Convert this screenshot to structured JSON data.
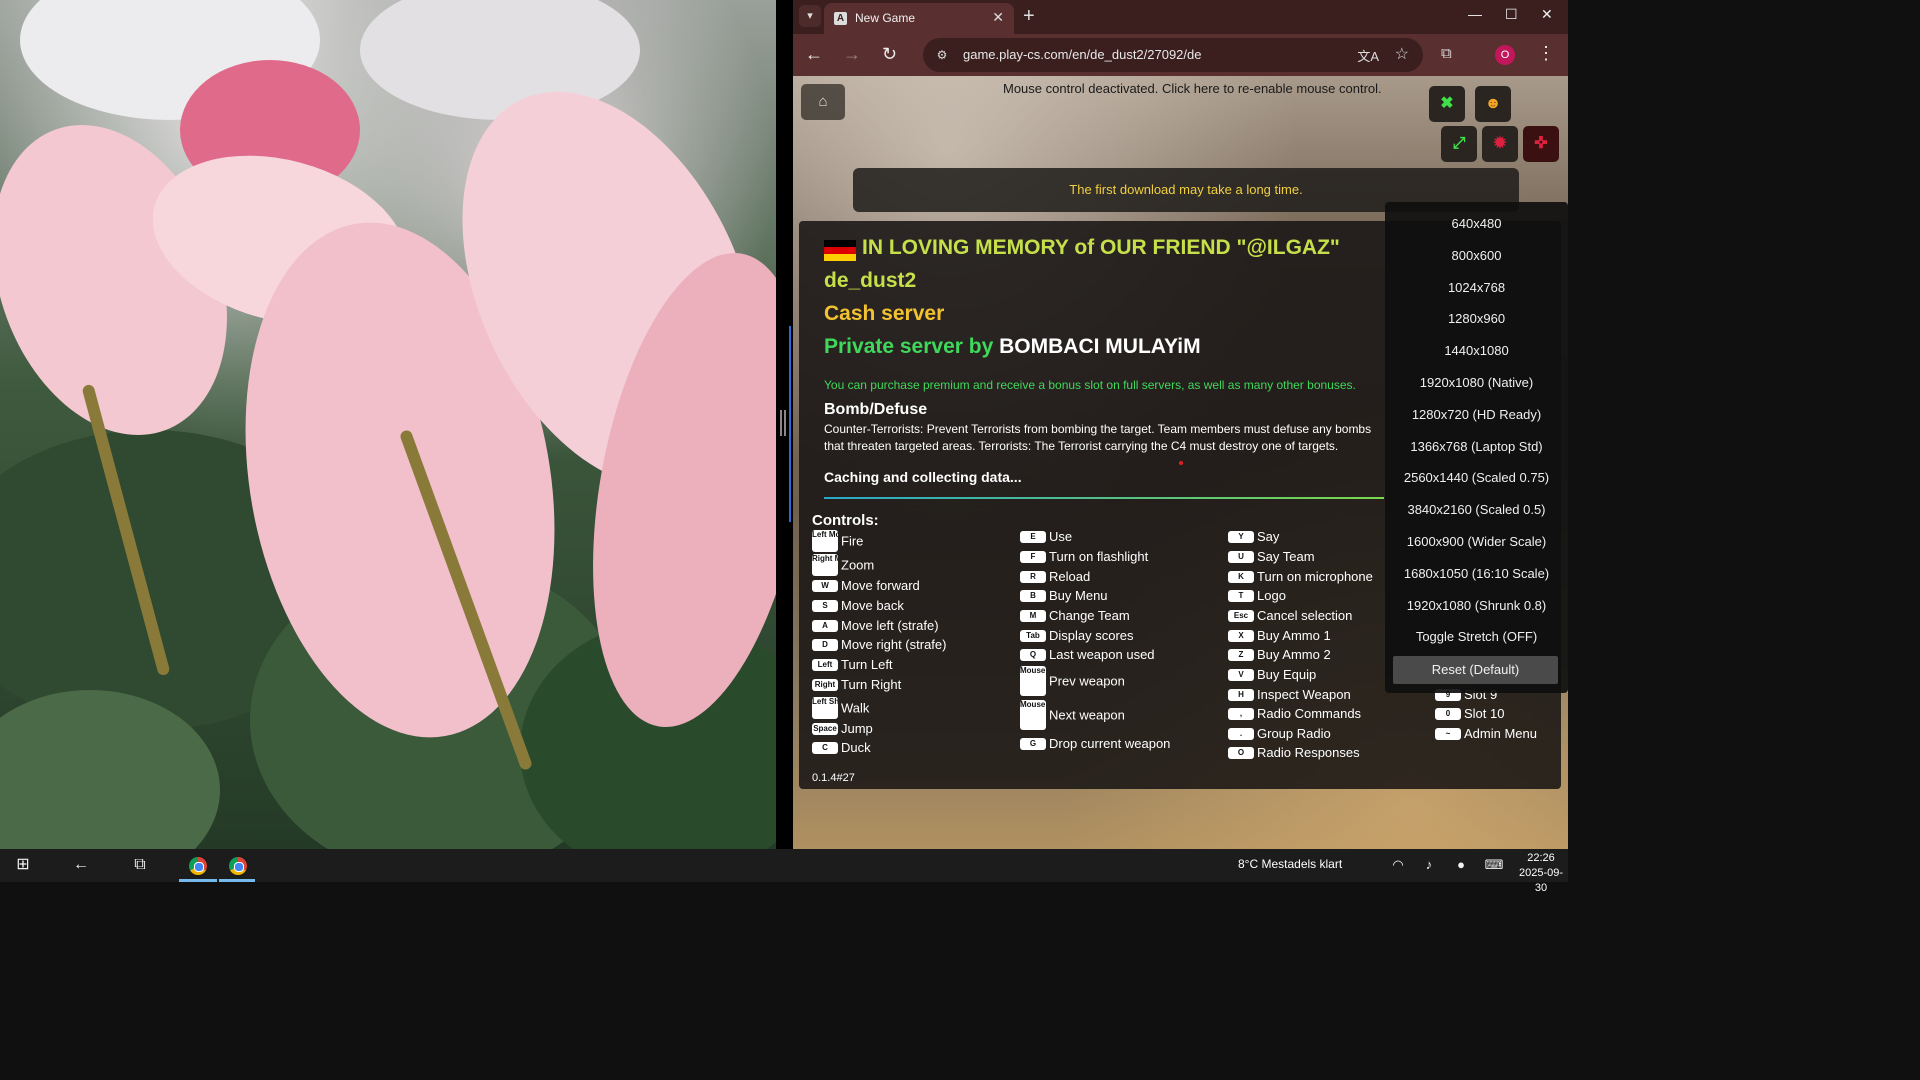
{
  "browser": {
    "tab_title": "New Game",
    "url": "game.play-cs.com/en/de_dust2/27092/de",
    "profile_initial": "O"
  },
  "game": {
    "mouse_message": "Mouse control deactivated. Click here to re-enable mouse control.",
    "download_banner": "The first download may take a long time.",
    "server_title": "IN LOVING MEMORY of OUR FRIEND \"@ILGAZ\"",
    "map": "de_dust2",
    "server_type": "Cash server",
    "private_label": "Private server by",
    "private_owner": "BOMBACI MULAYiM",
    "premium_note": "You can purchase premium and receive a bonus slot on full servers, as well as many other bonuses.",
    "mode_title": "Bomb/Defuse",
    "mode_description": "Counter-Terrorists: Prevent Terrorists from bombing the target. Team members must defuse any bombs that threaten targeted areas. Terrorists: The Terrorist carrying the C4 must destroy one of targets.",
    "status": "Caching and collecting data...",
    "controls_title": "Controls:",
    "version": "0.1.4#27",
    "flag_colors": [
      "#000000",
      "#dd0000",
      "#ffce00"
    ]
  },
  "controls": {
    "col1": [
      {
        "key": "Left Mouse",
        "action": "Fire"
      },
      {
        "key": "Right Mouse",
        "action": "Zoom"
      },
      {
        "key": "W",
        "action": "Move forward"
      },
      {
        "key": "S",
        "action": "Move back"
      },
      {
        "key": "A",
        "action": "Move left (strafe)"
      },
      {
        "key": "D",
        "action": "Move right (strafe)"
      },
      {
        "key": "Left",
        "action": "Turn Left"
      },
      {
        "key": "Right",
        "action": "Turn Right"
      },
      {
        "key": "Left Shift",
        "action": "Walk"
      },
      {
        "key": "Space",
        "action": "Jump"
      },
      {
        "key": "C",
        "action": "Duck"
      }
    ],
    "col2": [
      {
        "key": "E",
        "action": "Use"
      },
      {
        "key": "F",
        "action": "Turn on flashlight"
      },
      {
        "key": "R",
        "action": "Reload"
      },
      {
        "key": "B",
        "action": "Buy Menu"
      },
      {
        "key": "M",
        "action": "Change Team"
      },
      {
        "key": "Tab",
        "action": "Display scores"
      },
      {
        "key": "Q",
        "action": "Last weapon used"
      },
      {
        "key": "Mouse wheel up",
        "action": "Prev weapon"
      },
      {
        "key": "Mouse wheel down",
        "action": "Next weapon"
      },
      {
        "key": "G",
        "action": "Drop current weapon"
      }
    ],
    "col3": [
      {
        "key": "Y",
        "action": "Say"
      },
      {
        "key": "U",
        "action": "Say Team"
      },
      {
        "key": "K",
        "action": "Turn on microphone"
      },
      {
        "key": "T",
        "action": "Logo"
      },
      {
        "key": "Esc",
        "action": "Cancel selection"
      },
      {
        "key": "X",
        "action": "Buy Ammo 1"
      },
      {
        "key": "Z",
        "action": "Buy Ammo 2"
      },
      {
        "key": "V",
        "action": "Buy Equip"
      },
      {
        "key": "H",
        "action": "Inspect Weapon"
      },
      {
        "key": ",",
        "action": "Radio Commands"
      },
      {
        "key": ".",
        "action": "Group Radio"
      },
      {
        "key": "O",
        "action": "Radio Responses"
      }
    ],
    "col4": [
      {
        "key": "9",
        "action": "Slot 9"
      },
      {
        "key": "0",
        "action": "Slot 10"
      },
      {
        "key": "~",
        "action": "Admin Menu"
      }
    ]
  },
  "resolution_menu": [
    "640x480",
    "800x600",
    "1024x768",
    "1280x960",
    "1440x1080",
    "1920x1080 (Native)",
    "1280x720 (HD Ready)",
    "1366x768 (Laptop Std)",
    "2560x1440 (Scaled 0.75)",
    "3840x2160 (Scaled 0.5)",
    "1600x900 (Wider Scale)",
    "1680x1050 (16:10 Scale)",
    "1920x1080 (Shrunk 0.8)",
    "Toggle Stretch (OFF)",
    "Reset (Default)"
  ],
  "taskbar": {
    "weather": "8°C  Mestadels klart",
    "time": "22:26",
    "date": "2025-09-30"
  }
}
